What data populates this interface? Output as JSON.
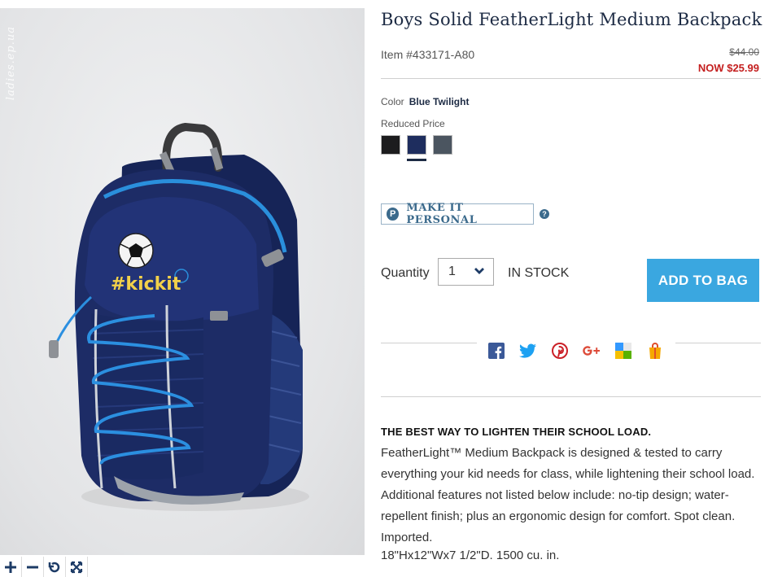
{
  "product": {
    "title": "Boys Solid FeatherLight Medium Backpack",
    "item_number": "Item #433171-A80",
    "price_was": "$44.00",
    "price_now": "NOW $25.99"
  },
  "image": {
    "watermark": "ladies.ep.ua",
    "embroidery_text": "#kickit"
  },
  "zoom_controls": [
    "zoom-in-icon",
    "zoom-out-icon",
    "rotate-icon",
    "fullscreen-icon"
  ],
  "color": {
    "label": "Color",
    "selected": "Blue Twilight",
    "price_note": "Reduced Price",
    "swatches": [
      {
        "name": "black",
        "hex": "#1c1c1e"
      },
      {
        "name": "blue-twilight",
        "hex": "#1e2d5e"
      },
      {
        "name": "gray",
        "hex": "#4b5560"
      }
    ]
  },
  "personalize": {
    "icon_letter": "P",
    "label": "MAKE IT PERSONAL",
    "help": "?"
  },
  "purchase": {
    "quantity_label": "Quantity",
    "quantity_value": "1",
    "stock": "IN STOCK",
    "add_to_bag": "ADD TO BAG"
  },
  "share_icons": [
    "facebook-icon",
    "twitter-icon",
    "pinterest-icon",
    "google-plus-icon",
    "delicious-icon",
    "shopping-bag-icon"
  ],
  "description": {
    "heading": "THE BEST WAY TO LIGHTEN THEIR SCHOOL LOAD.",
    "body": "FeatherLight™ Medium Backpack is designed & tested to carry everything your kid needs for class, while lightening their school load. Additional features not listed below include: no-tip design; water-repellent finish; plus an ergonomic design for comfort. Spot clean. Imported.",
    "dimensions": "18\"Hx12\"Wx7 1/2\"D. 1500 cu. in."
  },
  "colors": {
    "title": "#1d2b44",
    "sale_price": "#c41f1f",
    "accent_button": "#3aa7e0",
    "personalize": "#3b6a8c"
  }
}
